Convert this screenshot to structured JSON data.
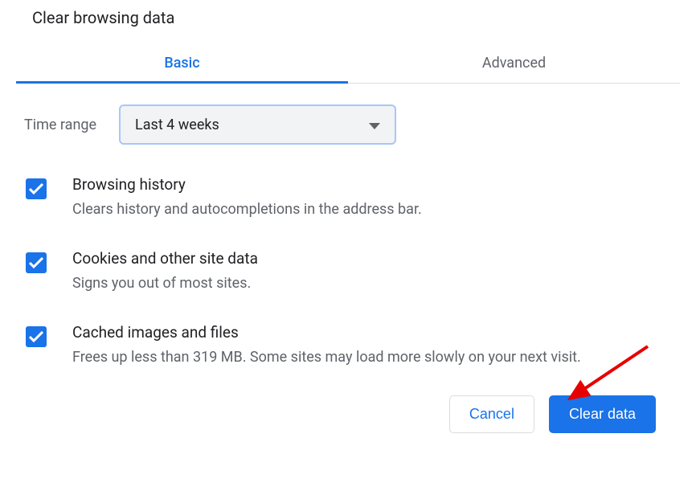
{
  "title": "Clear browsing data",
  "tabs": {
    "basic": "Basic",
    "advanced": "Advanced"
  },
  "timeRange": {
    "label": "Time range",
    "value": "Last 4 weeks"
  },
  "items": [
    {
      "title": "Browsing history",
      "desc": "Clears history and autocompletions in the address bar.",
      "checked": true
    },
    {
      "title": "Cookies and other site data",
      "desc": "Signs you out of most sites.",
      "checked": true
    },
    {
      "title": "Cached images and files",
      "desc": "Frees up less than 319 MB. Some sites may load more slowly on your next visit.",
      "checked": true
    }
  ],
  "buttons": {
    "cancel": "Cancel",
    "clear": "Clear data"
  }
}
